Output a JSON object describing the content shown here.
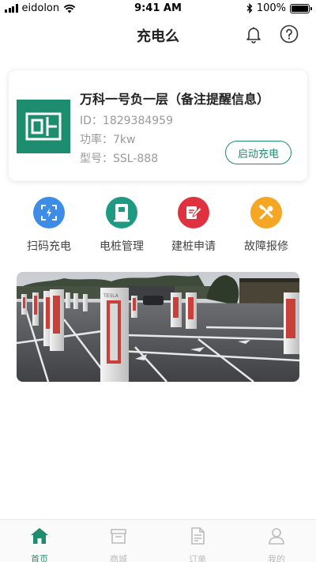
{
  "status_bar": {
    "carrier": "eidolon",
    "time": "9:41 AM",
    "battery": "100%",
    "battery_level": 1.0
  },
  "header": {
    "title": "充电么",
    "icons": [
      "bell-icon",
      "help-icon"
    ]
  },
  "station": {
    "title": "万科一号负一层（备注提醒信息）",
    "id_line": "ID：1829384959",
    "power_line": "功率：7kw",
    "model_line": "型号：SSL-888",
    "start_button": "启动充电"
  },
  "actions": [
    {
      "label": "扫码充电",
      "icon": "scan-icon",
      "color": "#3d8de6"
    },
    {
      "label": "电桩管理",
      "icon": "charger-icon",
      "color": "#1e9a82"
    },
    {
      "label": "建桩申请",
      "icon": "edit-icon",
      "color": "#e0323e"
    },
    {
      "label": "故障报修",
      "icon": "tools-icon",
      "color": "#f5a623"
    }
  ],
  "banner": {
    "charger_brand": "TESLA"
  },
  "tabbar": {
    "active_color": "#1e8c6e",
    "items": [
      {
        "label": "首页",
        "icon": "home-icon",
        "active": true
      },
      {
        "label": "商城",
        "icon": "store-icon",
        "active": false
      },
      {
        "label": "订单",
        "icon": "order-icon",
        "active": false
      },
      {
        "label": "我的",
        "icon": "profile-icon",
        "active": false
      }
    ]
  }
}
